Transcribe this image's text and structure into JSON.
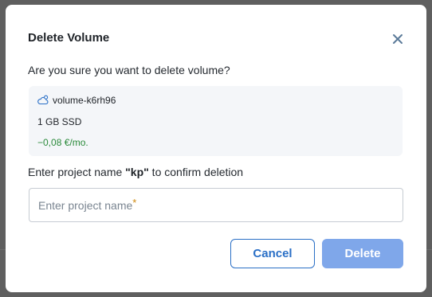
{
  "dialog": {
    "title": "Delete Volume",
    "close_icon": "close-icon",
    "question": "Are you sure you want to delete volume?",
    "volume": {
      "icon": "volume-cloud-icon",
      "name": "volume-k6rh96",
      "size": "1 GB SSD",
      "price": "−0,08 €/mo."
    },
    "confirm": {
      "prefix": "Enter project name ",
      "project_name": "\"kp\"",
      "suffix": " to confirm deletion"
    },
    "input": {
      "value": "",
      "placeholder": "Enter project name",
      "required_mark": "*"
    },
    "buttons": {
      "cancel": "Cancel",
      "delete": "Delete"
    }
  },
  "colors": {
    "primary": "#2a6fc6",
    "primary_disabled": "#7fa7ea",
    "price_green": "#2a8a3a",
    "required_orange": "#d08a10",
    "info_bg": "#f4f6f9"
  }
}
